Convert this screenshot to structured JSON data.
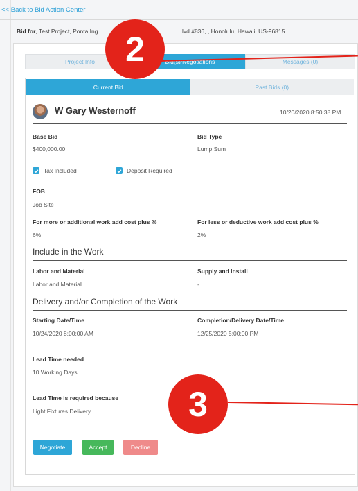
{
  "nav": {
    "back_label": "<< Back to Bid Action Center"
  },
  "bid_for": {
    "label": "Bid for",
    "text_a": ", Test Project, Ponta Ing",
    "text_b": "lvd #836, , Honolulu, Hawaii, US-96815"
  },
  "tabs": [
    {
      "label": "Project Info"
    },
    {
      "label": "Bid(s)/Negotiations"
    },
    {
      "label": "Messages (0)"
    }
  ],
  "subtabs": [
    {
      "label": "Current Bid"
    },
    {
      "label": "Past Bids (0)"
    }
  ],
  "bid": {
    "bidder": "W Gary Westernoff",
    "date": "10/20/2020 8:50:38 PM",
    "base_bid_label": "Base Bid",
    "base_bid_value": "$400,000.00",
    "bid_type_label": "Bid Type",
    "bid_type_value": "Lump Sum",
    "tax_included_label": "Tax Included",
    "deposit_required_label": "Deposit Required",
    "fob_label": "FOB",
    "fob_value": "Job Site",
    "more_work_label": "For more or additional work add cost plus %",
    "more_work_value": "6%",
    "less_work_label": "For less or deductive work add cost plus %",
    "less_work_value": "2%"
  },
  "include_work": {
    "heading": "Include in the Work",
    "labor_label": "Labor and Material",
    "labor_value": "Labor and Material",
    "supply_label": "Supply and Install",
    "supply_value": "-"
  },
  "delivery": {
    "heading": "Delivery and/or Completion of the Work",
    "start_label": "Starting Date/Time",
    "start_value": "10/24/2020 8:00:00 AM",
    "completion_label": "Completion/Delivery Date/Time",
    "completion_value": "12/25/2020 5:00:00 PM",
    "lead_time_label": "Lead Time needed",
    "lead_time_value": "10 Working Days",
    "lead_reason_label": "Lead Time is required because",
    "lead_reason_value": "Light Fixtures Delivery"
  },
  "actions": {
    "negotiate": "Negotiate",
    "accept": "Accept",
    "decline": "Decline"
  },
  "annotations": {
    "badge_2": "2",
    "badge_3": "3"
  },
  "colors": {
    "accent": "#2ea6d7",
    "accept": "#46b85b",
    "decline": "#ef8a8a",
    "annotation": "#e3231a"
  },
  "icons": {
    "checkbox": "checkmark-icon",
    "avatar": "user-photo"
  }
}
